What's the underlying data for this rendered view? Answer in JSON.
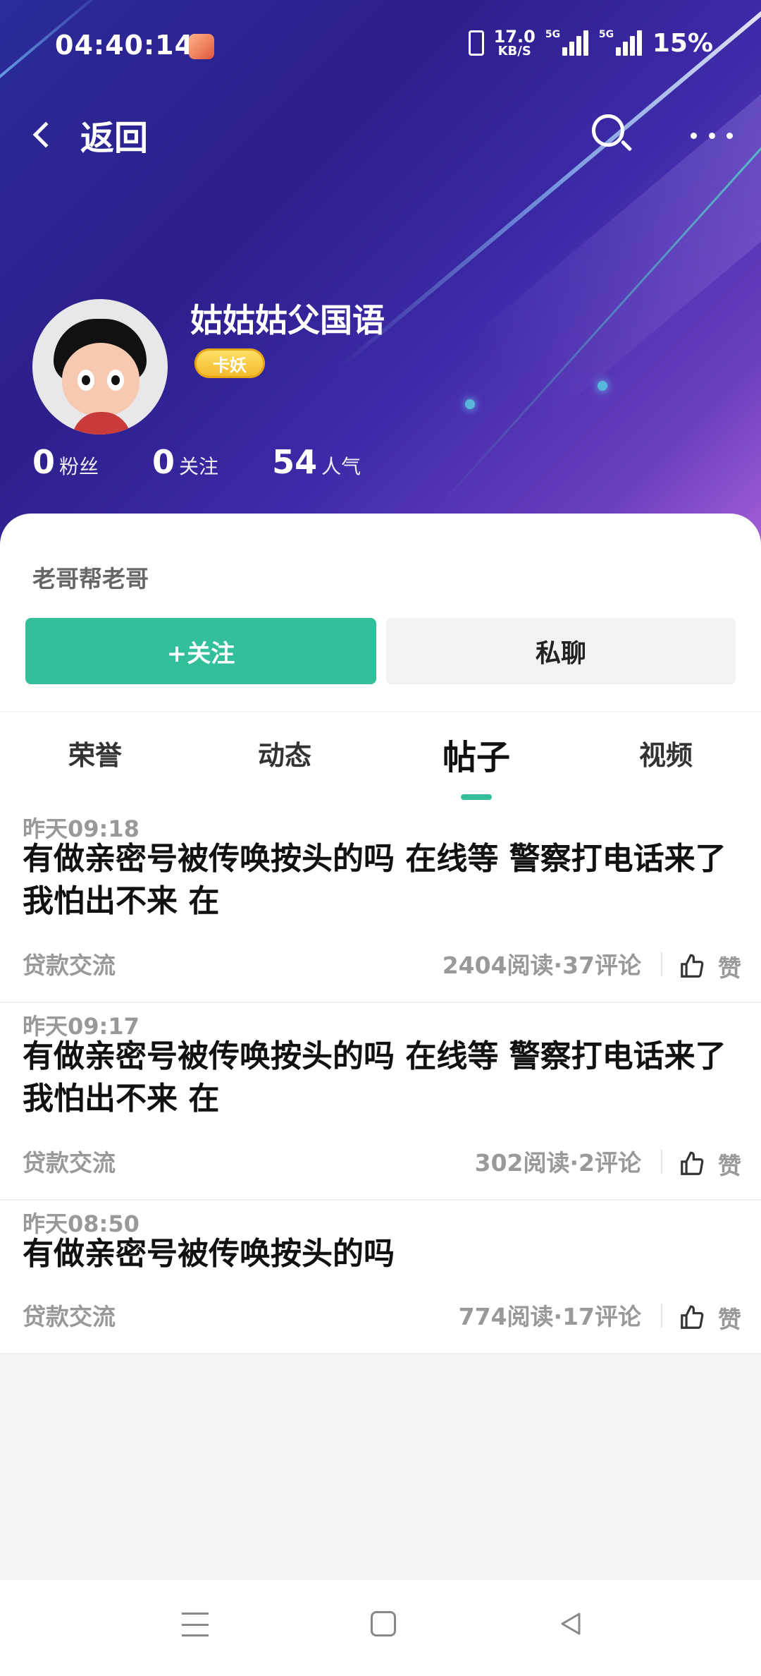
{
  "status_bar": {
    "time": "04:40:14",
    "net_speed_value": "17.0",
    "net_speed_unit": "KB/S",
    "signal1_label": "5G",
    "signal2_label": "5G",
    "battery": "15%"
  },
  "nav": {
    "back_label": "返回"
  },
  "profile": {
    "username": "姑姑姑父国语",
    "badge": "卡妖",
    "stats": [
      {
        "value": "0",
        "label": "粉丝"
      },
      {
        "value": "0",
        "label": "关注"
      },
      {
        "value": "54",
        "label": "人气"
      }
    ],
    "bio": "老哥帮老哥",
    "follow_label": "+关注",
    "chat_label": "私聊"
  },
  "tabs": [
    {
      "label": "荣誉"
    },
    {
      "label": "动态"
    },
    {
      "label": "帖子",
      "active": true
    },
    {
      "label": "视频"
    }
  ],
  "posts": [
    {
      "time": "昨天09:18",
      "title": "有做亲密号被传唤按头的吗 在线等 警察打电话来了 我怕出不来 在",
      "category": "贷款交流",
      "stats": "2404阅读·37评论",
      "like_label": "赞"
    },
    {
      "time": "昨天09:17",
      "title": "有做亲密号被传唤按头的吗 在线等 警察打电话来了 我怕出不来 在",
      "category": "贷款交流",
      "stats": "302阅读·2评论",
      "like_label": "赞"
    },
    {
      "time": "昨天08:50",
      "title": "有做亲密号被传唤按头的吗",
      "category": "贷款交流",
      "stats": "774阅读·17评论",
      "like_label": "赞"
    }
  ],
  "colors": {
    "accent": "#33bf99",
    "header_start": "#2b2a9a",
    "header_end": "#a45fd6"
  }
}
